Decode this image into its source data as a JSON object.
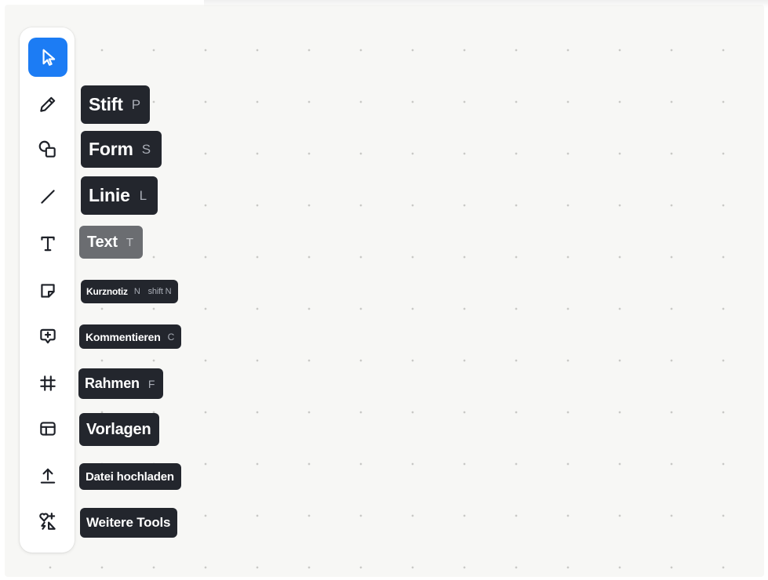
{
  "toolbar": {
    "tools": [
      {
        "id": "select",
        "icon": "cursor-icon",
        "active": true
      },
      {
        "id": "pen",
        "icon": "pencil-icon",
        "label": "Stift",
        "shortcut": "P"
      },
      {
        "id": "shape",
        "icon": "shapes-icon",
        "label": "Form",
        "shortcut": "S"
      },
      {
        "id": "line",
        "icon": "line-icon",
        "label": "Linie",
        "shortcut": "L"
      },
      {
        "id": "text",
        "icon": "text-icon",
        "label": "Text",
        "shortcut": "T"
      },
      {
        "id": "sticky",
        "icon": "sticky-note-icon",
        "label": "Kurznotiz",
        "shortcut": "N",
        "shortcut2": "shift N"
      },
      {
        "id": "comment",
        "icon": "comment-icon",
        "label": "Kommentieren",
        "shortcut": "C"
      },
      {
        "id": "frame",
        "icon": "frame-icon",
        "label": "Rahmen",
        "shortcut": "F"
      },
      {
        "id": "templates",
        "icon": "templates-icon",
        "label": "Vorlagen"
      },
      {
        "id": "upload",
        "icon": "upload-icon",
        "label": "Datei hochladen"
      },
      {
        "id": "more",
        "icon": "more-tools-icon",
        "label": "Weitere Tools"
      }
    ]
  },
  "colors": {
    "accent": "#1c7cf4",
    "tooltip_bg": "#23262d",
    "canvas_bg": "#f7f7f5",
    "grid_dot": "#c9c9c6"
  }
}
